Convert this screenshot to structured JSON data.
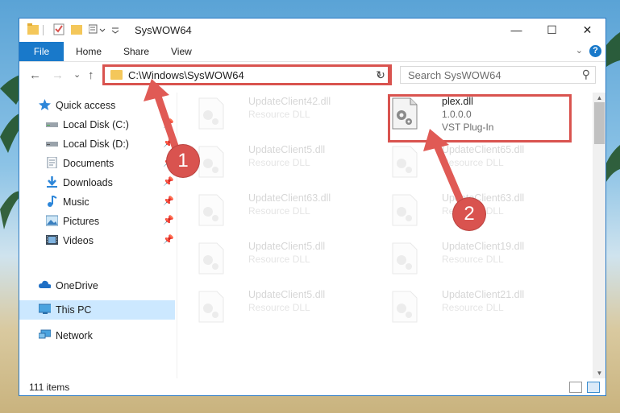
{
  "window": {
    "title": "SysWOW64",
    "minimize_glyph": "—",
    "maximize_glyph": "☐",
    "close_glyph": "✕"
  },
  "ribbon": {
    "tabs": [
      "File",
      "Home",
      "Share",
      "View"
    ],
    "collapse_glyph": "⌄",
    "help_glyph": "?"
  },
  "nav": {
    "back_glyph": "←",
    "forward_glyph": "→",
    "recent_glyph": "⌄",
    "up_glyph": "↑",
    "address": "C:\\Windows\\SysWOW64",
    "address_dropdown_glyph": "⌄",
    "refresh_glyph": "↻",
    "search_placeholder": "Search SysWOW64",
    "search_glyph": "⚲"
  },
  "sidebar": {
    "items": [
      {
        "label": "Quick access",
        "icon": "star-icon"
      },
      {
        "label": "Local Disk (C:)",
        "icon": "drive-icon"
      },
      {
        "label": "Local Disk (D:)",
        "icon": "drive-icon"
      },
      {
        "label": "Documents",
        "icon": "documents-icon"
      },
      {
        "label": "Downloads",
        "icon": "downloads-icon"
      },
      {
        "label": "Music",
        "icon": "music-icon"
      },
      {
        "label": "Pictures",
        "icon": "pictures-icon"
      },
      {
        "label": "Videos",
        "icon": "videos-icon"
      },
      {
        "label": "OneDrive",
        "icon": "cloud-icon"
      },
      {
        "label": "This PC",
        "icon": "computer-icon"
      },
      {
        "label": "Network",
        "icon": "network-icon"
      }
    ],
    "pin_glyph": "📌"
  },
  "files": [
    {
      "name": "UpdateClient42.dll",
      "type": "Resource DLL"
    },
    {
      "name": "plex.dll",
      "version": "1.0.0.0",
      "type": "VST Plug-In"
    },
    {
      "name": "UpdateClient5.dll",
      "type": "Resource DLL"
    },
    {
      "name": "UpdateClient65.dll",
      "type": "Resource DLL"
    },
    {
      "name": "UpdateClient63.dll",
      "type": "Resource DLL"
    },
    {
      "name": "UpdateClient63.dll",
      "type": "Resource DLL"
    },
    {
      "name": "UpdateClient5.dll",
      "type": "Resource DLL"
    },
    {
      "name": "UpdateClient19.dll",
      "type": "Resource DLL"
    },
    {
      "name": "UpdateClient5.dll",
      "type": "Resource DLL"
    },
    {
      "name": "UpdateClient21.dll",
      "type": "Resource DLL"
    }
  ],
  "status": {
    "item_count": "111 items"
  },
  "annotations": {
    "badge1": "1",
    "badge2": "2",
    "color": "#d9534f"
  },
  "colors": {
    "accent": "#1979ca",
    "selection": "#cce8ff",
    "highlight": "#d9534f"
  }
}
